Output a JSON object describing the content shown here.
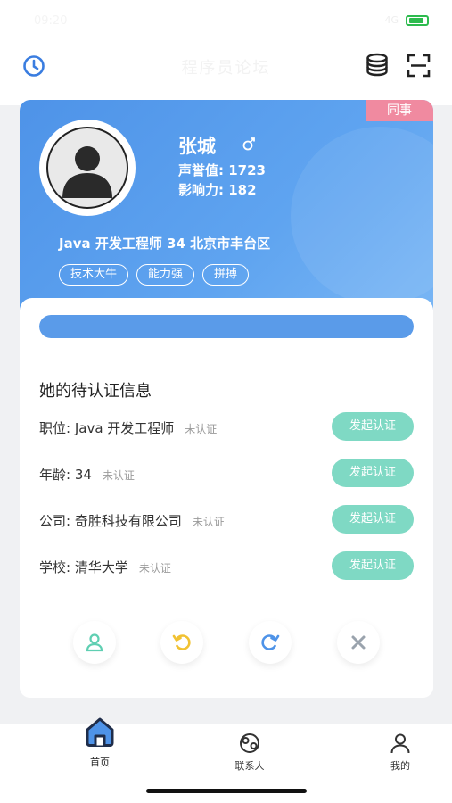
{
  "status_bar": {
    "time": "09:20",
    "signal": "4G"
  },
  "header": {
    "title": "程序员论坛"
  },
  "icons": {
    "clock": "clock-icon",
    "database": "database-icon",
    "scan": "scan-icon",
    "gender": "male-icon",
    "add_user": "user-icon",
    "undo": "undo-icon",
    "redo": "redo-icon",
    "close": "close-icon"
  },
  "profile": {
    "badge": "同事",
    "name": "张城",
    "reputation": "声誉值: 1723",
    "influence": "影响力: 182",
    "info": "Java 开发工程师 34 北京市丰台区",
    "tags": [
      "技术大牛",
      "能力强",
      "拼搏"
    ]
  },
  "progress": {
    "value": 1.0
  },
  "verification": {
    "title": "她的待认证信息",
    "button_label": "发起认证",
    "rows": [
      {
        "label": "职位: Java 开发工程师",
        "status": "未认证"
      },
      {
        "label": "年龄: 34",
        "status": "未认证"
      },
      {
        "label": "公司: 奇胜科技有限公司",
        "status": "未认证"
      },
      {
        "label": "学校: 清华大学",
        "status": "未认证"
      }
    ]
  },
  "tabbar": {
    "items": [
      {
        "label": "首页",
        "icon": "home-icon"
      },
      {
        "label": "联系人",
        "icon": "contacts-icon"
      },
      {
        "label": "我的",
        "icon": "profile-icon"
      }
    ]
  },
  "colors": {
    "primary": "#5a9be9",
    "accent_green": "#7fd9c4",
    "badge_pink": "#f08aa0",
    "undo_yellow": "#f1c232",
    "redo_blue": "#4e93e8"
  }
}
